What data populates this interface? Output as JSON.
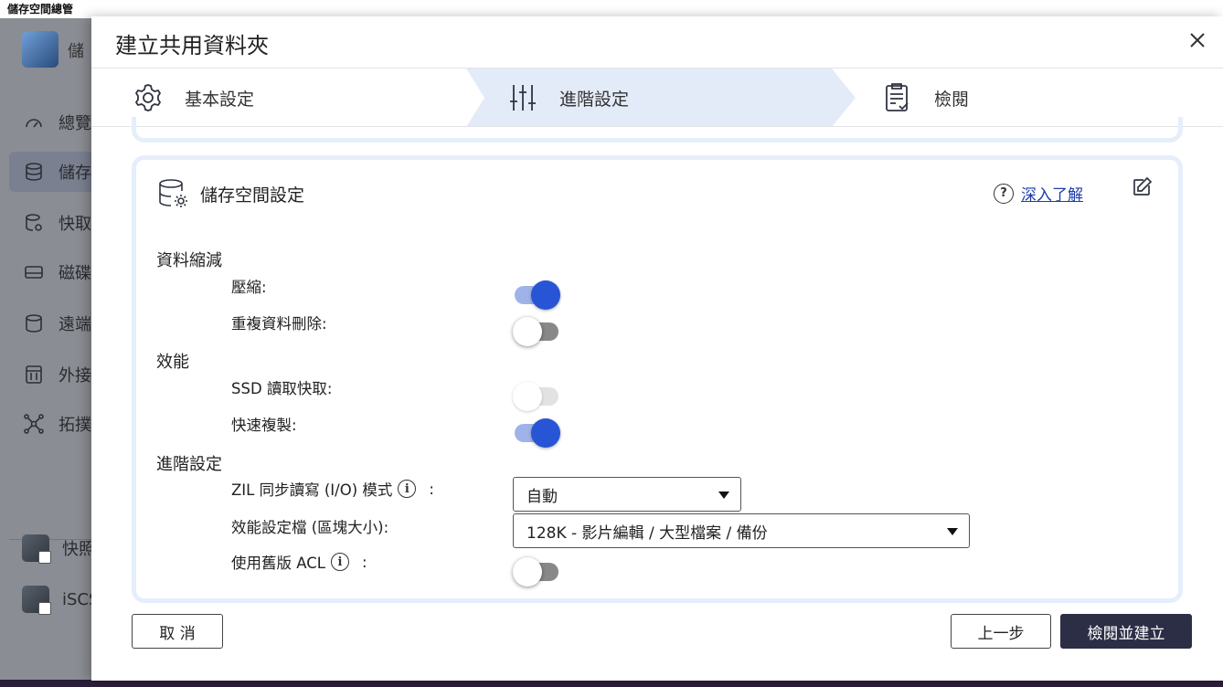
{
  "app": {
    "title": "儲存空間總管",
    "header_label": "儲",
    "sidebar": [
      {
        "label": "總覽",
        "icon": "gauge-icon"
      },
      {
        "label": "儲存",
        "icon": "database-icon"
      },
      {
        "label": "快取",
        "icon": "cache-icon"
      },
      {
        "label": "磁碟",
        "icon": "disk-icon"
      },
      {
        "label": "遠端",
        "icon": "remote-disk-icon"
      },
      {
        "label": "外接",
        "icon": "external-device-icon"
      },
      {
        "label": "拓撲",
        "icon": "topology-icon"
      }
    ],
    "sidebar_apps": [
      {
        "label": "快照"
      },
      {
        "label": "iSCS"
      }
    ]
  },
  "dialog": {
    "title": "建立共用資料夾",
    "steps": [
      {
        "label": "基本設定",
        "icon": "gear-icon"
      },
      {
        "label": "進階設定",
        "icon": "sliders-icon"
      },
      {
        "label": "檢閱",
        "icon": "clipboard-check-icon"
      }
    ],
    "card": {
      "title": "儲存空間設定",
      "learn_more": "深入了解",
      "sections": {
        "data_reduction": "資料縮減",
        "performance": "效能",
        "advanced": "進階設定"
      },
      "rows": {
        "compression": {
          "label": "壓縮:",
          "enabled": true
        },
        "dedup": {
          "label": "重複資料刪除:",
          "enabled": false
        },
        "ssd_cache": {
          "label": "SSD 讀取快取:",
          "enabled": false,
          "disabled": true
        },
        "fast_clone": {
          "label": "快速複製:",
          "enabled": true
        },
        "zil": {
          "label": "ZIL 同步讀寫 (I/O) 模式",
          "colon": ":",
          "value": "自動"
        },
        "profile": {
          "label": "效能設定檔 (區塊大小):",
          "value": "128K - 影片編輯 / 大型檔案 / 備份"
        },
        "legacy_acl": {
          "label": "使用舊版 ACL",
          "colon": ":",
          "enabled": false
        }
      }
    },
    "buttons": {
      "cancel": "取 消",
      "back": "上一步",
      "review_create": "檢閱並建立"
    }
  },
  "colors": {
    "accent": "#2854d6",
    "step_active_bg": "#e4ebf8",
    "card_border": "#e6eefb",
    "primary_button": "#2b2e45"
  }
}
